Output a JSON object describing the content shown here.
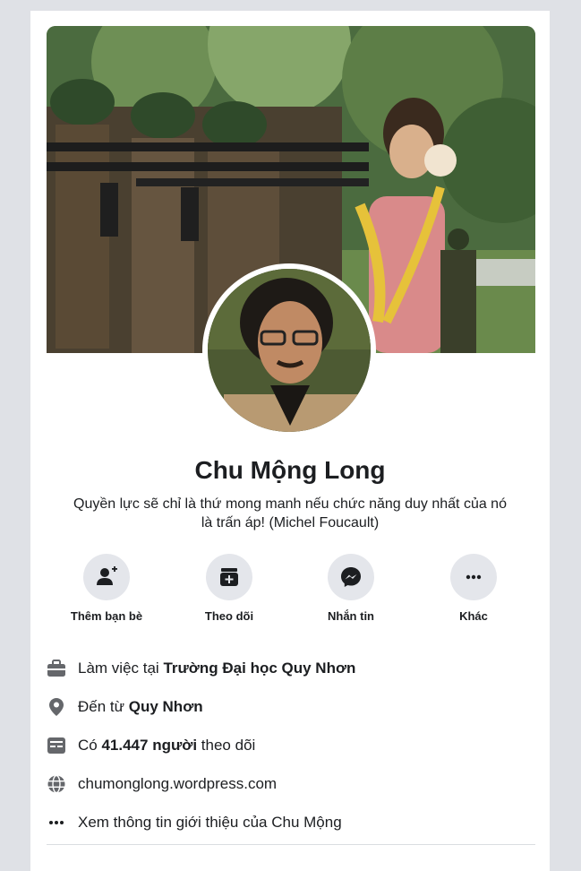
{
  "profile": {
    "name": "Chu Mộng Long",
    "bio_line1": "Quyền lực sẽ chỉ là thứ mong manh nếu chức năng duy nhất của nó",
    "bio_line2": "là trấn áp! (Michel Foucault)"
  },
  "actions": [
    {
      "label": "Thêm bạn bè",
      "icon": "add-friend-icon"
    },
    {
      "label": "Theo dõi",
      "icon": "follow-icon"
    },
    {
      "label": "Nhắn tin",
      "icon": "messenger-icon"
    },
    {
      "label": "Khác",
      "icon": "more-icon"
    }
  ],
  "intro": {
    "work_prefix": "Làm việc tại ",
    "work_place": "Trường Đại học Quy Nhơn",
    "from_prefix": "Đến từ ",
    "from_place": "Quy Nhơn",
    "followers_prefix": "Có ",
    "followers_count": "41.447 người",
    "followers_suffix": " theo dõi",
    "website": "chumonglong.wordpress.com",
    "see_more": "Xem thông tin giới thiệu của Chu Mộng"
  },
  "colors": {
    "page_bg": "#dfe1e6",
    "icon_bg": "#e4e6eb",
    "icon_gray": "#65676b",
    "text": "#1c1e21"
  }
}
